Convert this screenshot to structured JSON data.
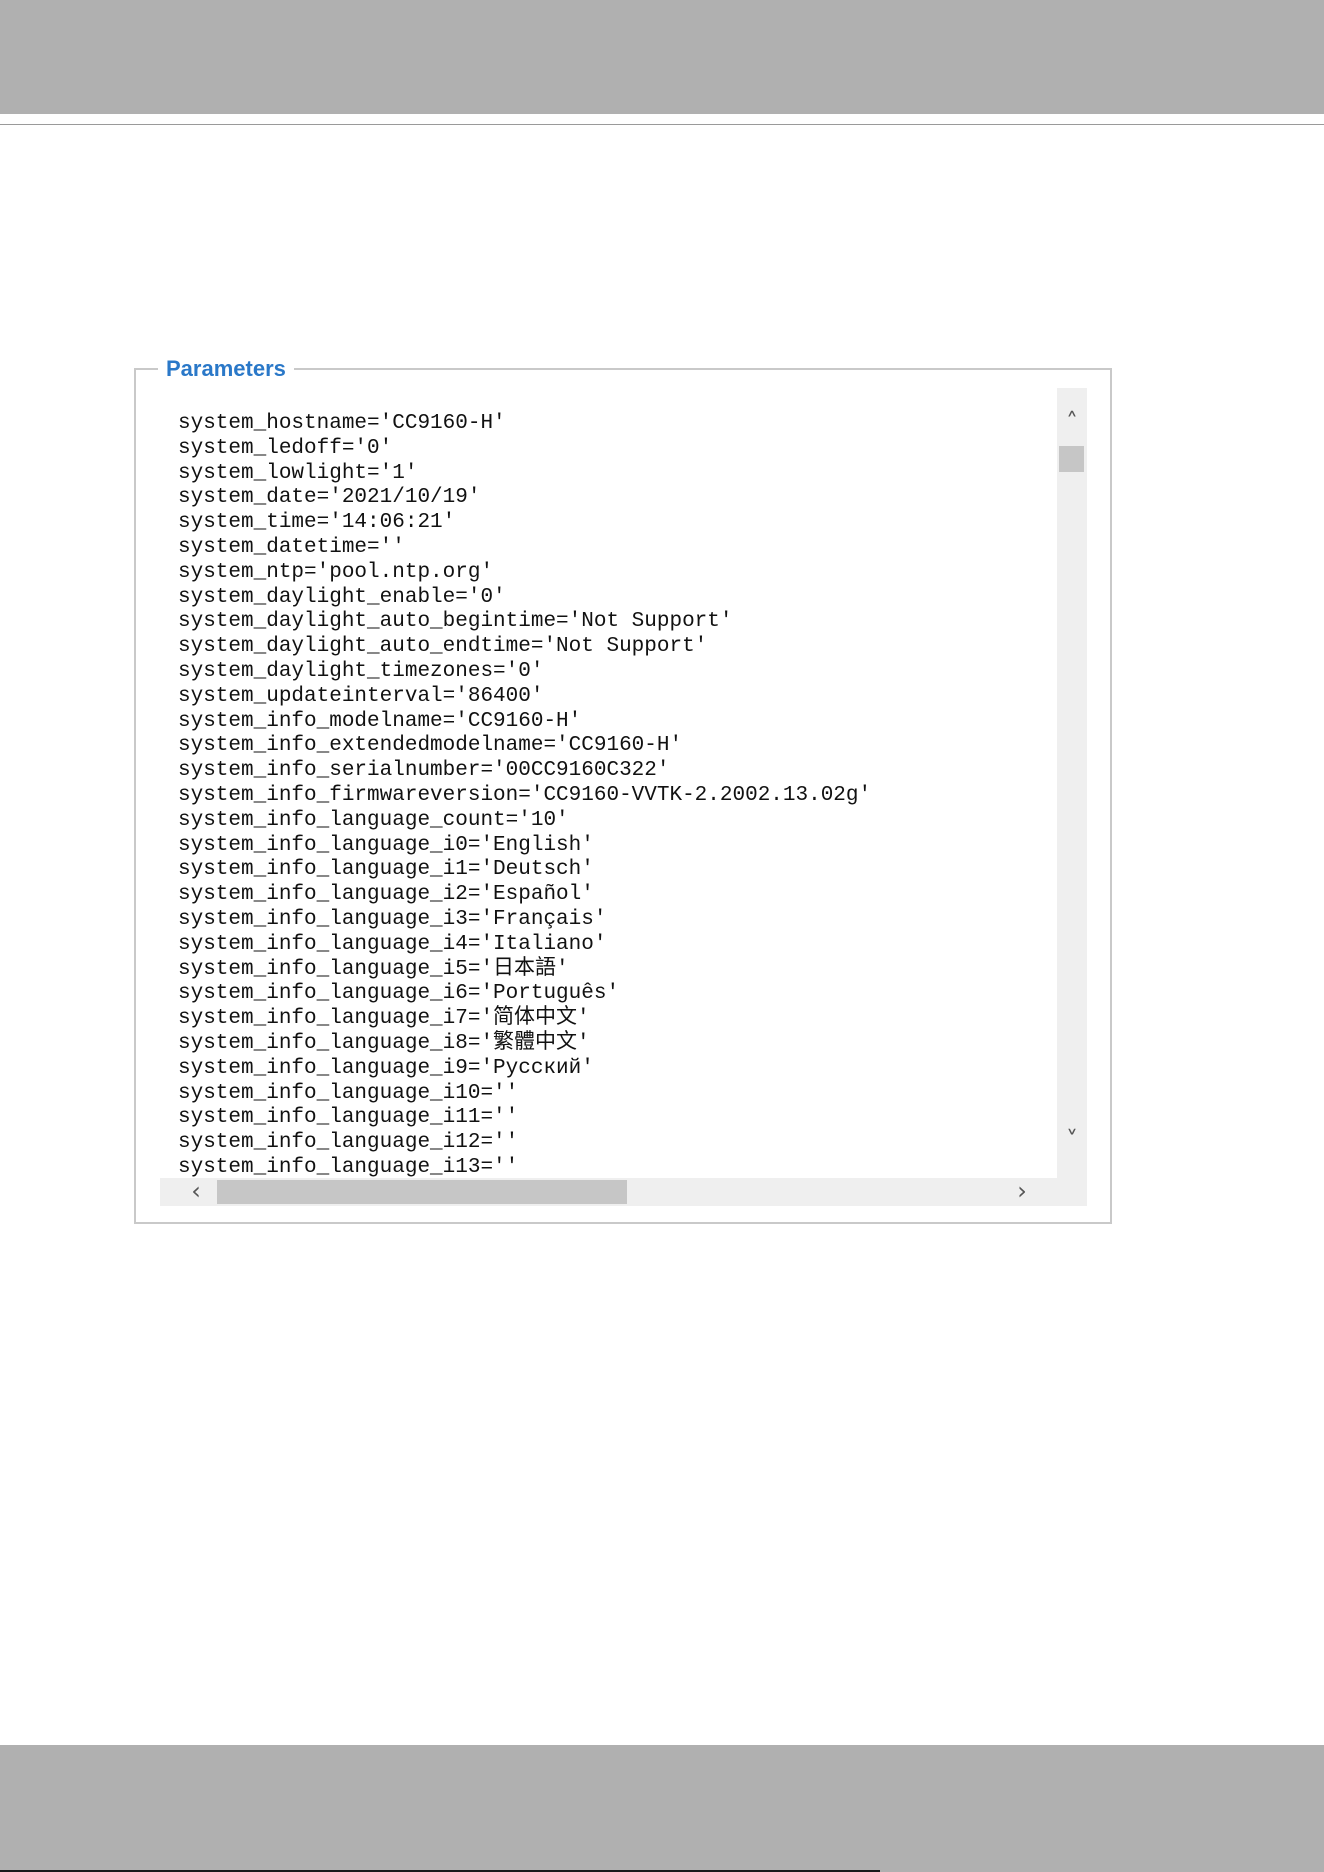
{
  "panel": {
    "legend": "Parameters"
  },
  "parameters": [
    "system_hostname='CC9160-H'",
    "system_ledoff='0'",
    "system_lowlight='1'",
    "system_date='2021/10/19'",
    "system_time='14:06:21'",
    "system_datetime=''",
    "system_ntp='pool.ntp.org'",
    "system_daylight_enable='0'",
    "system_daylight_auto_begintime='Not Support'",
    "system_daylight_auto_endtime='Not Support'",
    "system_daylight_timezones='0'",
    "system_updateinterval='86400'",
    "system_info_modelname='CC9160-H'",
    "system_info_extendedmodelname='CC9160-H'",
    "system_info_serialnumber='00CC9160C322'",
    "system_info_firmwareversion='CC9160-VVTK-2.2002.13.02g'",
    "system_info_language_count='10'",
    "system_info_language_i0='English'",
    "system_info_language_i1='Deutsch'",
    "system_info_language_i2='Español'",
    "system_info_language_i3='Français'",
    "system_info_language_i4='Italiano'",
    "system_info_language_i5='日本語'",
    "system_info_language_i6='Português'",
    "system_info_language_i7='简体中文'",
    "system_info_language_i8='繁體中文'",
    "system_info_language_i9='Русский'",
    "system_info_language_i10=''",
    "system_info_language_i11=''",
    "system_info_language_i12=''",
    "system_info_language_i13=''"
  ],
  "icons": {
    "scroll_up": "chevron-up-icon",
    "scroll_down": "chevron-down-icon",
    "scroll_left": "chevron-left-icon",
    "scroll_right": "chevron-right-icon"
  },
  "colors": {
    "legend": "#2a78c8",
    "band": "#b0b0b0",
    "scrollbar_track": "#efefef",
    "scrollbar_thumb": "#c6c6c6"
  }
}
